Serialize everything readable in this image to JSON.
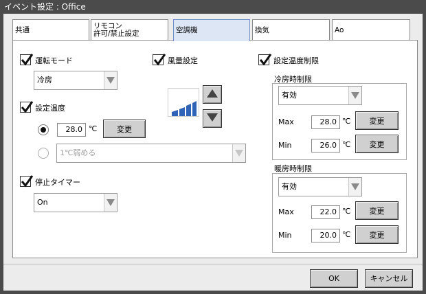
{
  "window": {
    "title": "イベント設定 : Office"
  },
  "tabs": [
    {
      "label": "共通"
    },
    {
      "label_line1": "リモコン",
      "label_line2": "許可/禁止設定"
    },
    {
      "label": "空調機"
    },
    {
      "label": "換気"
    },
    {
      "label": "Ao"
    }
  ],
  "mode": {
    "label": "運転モード",
    "value": "冷房"
  },
  "fan": {
    "label": "風量設定"
  },
  "setpoint": {
    "label": "設定温度",
    "value": "28.0",
    "unit": "℃",
    "change_label": "変更",
    "option_value": "1℃弱める"
  },
  "timer": {
    "label": "停止タイマー",
    "value": "On"
  },
  "limit": {
    "label": "設定温度制限",
    "cool": {
      "title": "冷房時制限",
      "state": "有効",
      "max_label": "Max",
      "max_value": "28.0",
      "min_label": "Min",
      "min_value": "26.0",
      "unit": "℃",
      "change_label": "変更"
    },
    "heat": {
      "title": "暖房時制限",
      "state": "有効",
      "max_label": "Max",
      "max_value": "22.0",
      "min_label": "Min",
      "min_value": "20.0",
      "unit": "℃",
      "change_label": "変更"
    }
  },
  "footer": {
    "ok_label": "OK",
    "cancel_label": "キャンセル"
  },
  "colors": {
    "frame": "#4b4b4b",
    "client": "#ececec",
    "button": "#d0d0d0",
    "fan_bars": "#2e63b8",
    "active_tab": "#dde6f4"
  }
}
